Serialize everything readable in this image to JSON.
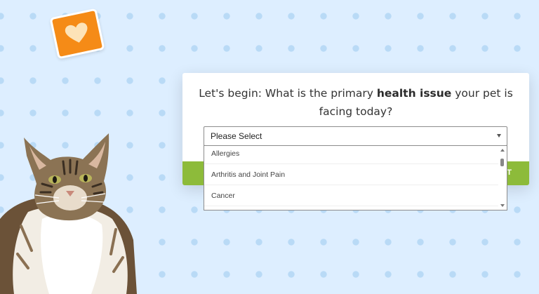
{
  "brand": {
    "logo_icon": "heart-icon",
    "logo_color": "#f58b17"
  },
  "question": {
    "prefix": "Let's begin: What is the primary ",
    "emphasis": "health issue",
    "suffix": " your pet is facing today?"
  },
  "select": {
    "value": "Please Select",
    "options": [
      "Allergies",
      "Arthritis and Joint Pain",
      "Cancer"
    ]
  },
  "footer": {
    "next_label": "T",
    "color": "#8dbb3a"
  },
  "illustration": {
    "icon": "cat-photo"
  }
}
